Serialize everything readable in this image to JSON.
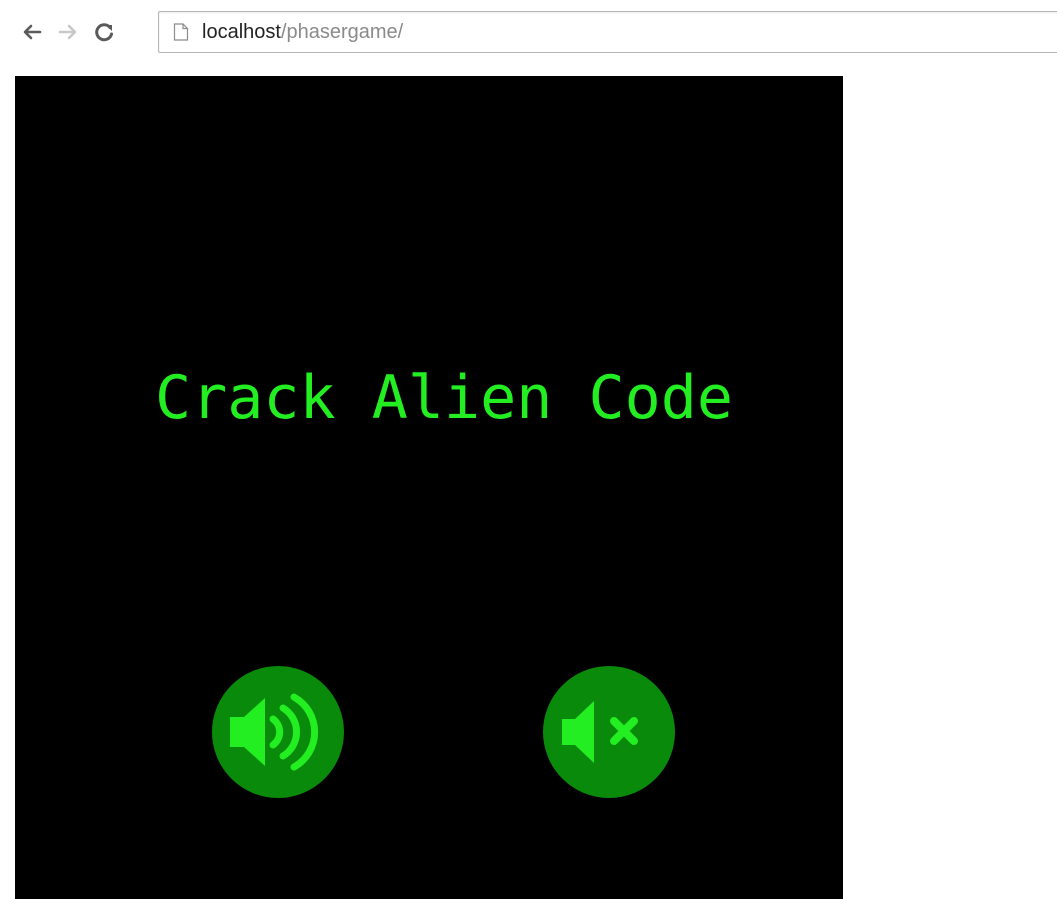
{
  "browser": {
    "url_host": "localhost",
    "url_path": "/phasergame/",
    "icons": {
      "back": "arrow-left-icon",
      "forward": "arrow-right-icon",
      "reload": "reload-icon",
      "page": "page-icon"
    }
  },
  "game": {
    "title": "Crack Alien Code",
    "title_color": "#22ee22",
    "background_color": "#000000",
    "button_color": "#0a8a0a",
    "button_icon_color": "#22ee22",
    "buttons": {
      "sound_on": "speaker-on-icon",
      "sound_off": "speaker-mute-icon"
    }
  }
}
